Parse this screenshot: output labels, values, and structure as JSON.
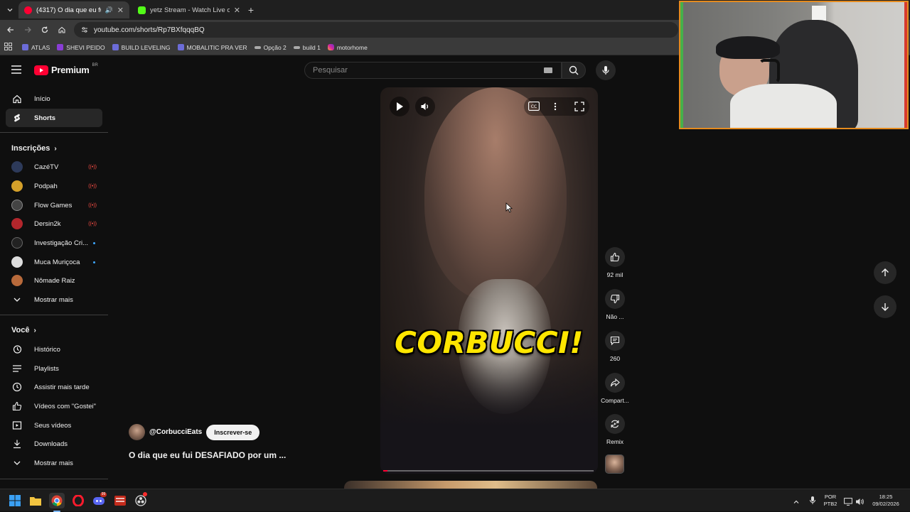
{
  "browser": {
    "tabs": [
      {
        "title": "(4317) O dia que eu fui DES...",
        "active": true
      },
      {
        "title": "yetz Stream - Watch Live on Ki...",
        "active": false
      }
    ],
    "new_tab": "+",
    "url": "youtube.com/shorts/Rp7BXfqqqBQ",
    "bookmarks": [
      "ATLAS",
      "SHEVI PEIDO",
      "BUILD LEVELING",
      "MOBALITIC PRA VER",
      "Opção 2",
      "build 1",
      "motorhome"
    ]
  },
  "masthead": {
    "logo_text": "Premium",
    "logo_region": "BR",
    "search_placeholder": "Pesquisar"
  },
  "sidebar": {
    "main": [
      {
        "label": "Início",
        "icon": "home-icon"
      },
      {
        "label": "Shorts",
        "icon": "shorts-icon",
        "active": true
      }
    ],
    "subscriptions_header": "Inscrições",
    "subscriptions": [
      {
        "label": "CazéTV",
        "status": "live",
        "color": "#2d3a5a"
      },
      {
        "label": "Podpah",
        "status": "live",
        "color": "#d4a02a"
      },
      {
        "label": "Flow Games",
        "status": "live",
        "color": "#444"
      },
      {
        "label": "Dersin2k",
        "status": "live",
        "color": "#b3262c"
      },
      {
        "label": "Investigação Cri...",
        "status": "new",
        "color": "#222"
      },
      {
        "label": "Muca Muriçoca",
        "status": "new",
        "color": "#ddd"
      },
      {
        "label": "Nômade Raiz",
        "status": "",
        "color": "#b86a3b"
      }
    ],
    "subscriptions_more": "Mostrar mais",
    "you_header": "Você",
    "you": [
      {
        "label": "Histórico",
        "icon": "history-icon"
      },
      {
        "label": "Playlists",
        "icon": "playlists-icon"
      },
      {
        "label": "Assistir mais tarde",
        "icon": "watch-later-icon"
      },
      {
        "label": "Vídeos com \"Gostei\"",
        "icon": "liked-videos-icon"
      },
      {
        "label": "Seus vídeos",
        "icon": "your-videos-icon"
      },
      {
        "label": "Downloads",
        "icon": "downloads-icon"
      },
      {
        "label": "Mostrar mais",
        "icon": "chevron-down-icon"
      }
    ]
  },
  "player": {
    "caption": "CORBUCCI!",
    "progress": 0.02
  },
  "actions": {
    "likes": "92 mil",
    "dislike": "Não ...",
    "comments": "260",
    "share": "Compart...",
    "remix": "Remix"
  },
  "video": {
    "channel": "@CorbucciEats",
    "subscribe": "Inscrever-se",
    "title": "O dia que eu fui DESAFIADO por um ..."
  },
  "taskbar": {
    "lang": "POR",
    "layout": "PTB2",
    "time": "18:25",
    "date": "09/02/2026"
  },
  "colors": {
    "yt_red": "#ff0033",
    "webcam_border": "#e58b1e",
    "caption": "#ffe600"
  }
}
